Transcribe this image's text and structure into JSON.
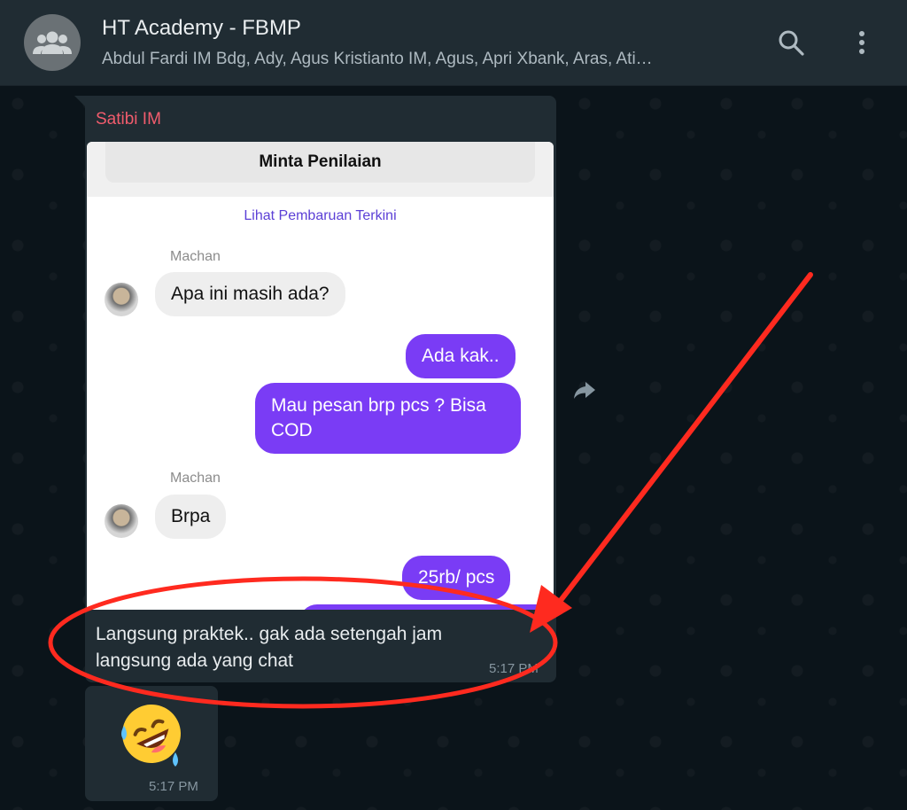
{
  "header": {
    "title": "HT Academy - FBMP",
    "members": "Abdul Fardi IM Bdg, Ady, Agus Kristianto IM, Agus, Apri Xbank, Aras, Ati…",
    "avatar_icon": "group-icon",
    "search_icon": "search-icon",
    "menu_icon": "more-vertical-icon"
  },
  "message": {
    "sender": "Satibi IM",
    "sender_color": "#f15c6d",
    "caption": "Langsung praktek.. gak ada setengah jam langsung ada yang chat",
    "time": "5:17 PM",
    "forward_icon": "forward-icon",
    "screenshot": {
      "rate_button": "Minta Penilaian",
      "update_link": "Lihat Pembaruan Terkini",
      "name1": "Machan",
      "msg1": "Apa ini masih ada?",
      "reply1": "Ada kak..",
      "reply2": "Mau pesan brp pcs ? Bisa COD",
      "name2": "Machan",
      "msg2": "Brpa",
      "reply3": "25rb/ pcs"
    }
  },
  "emoji_message": {
    "emoji": "rolling-on-the-floor-laughing-emoji",
    "time": "5:17 PM"
  },
  "annotation_color": "#ff2a1f"
}
